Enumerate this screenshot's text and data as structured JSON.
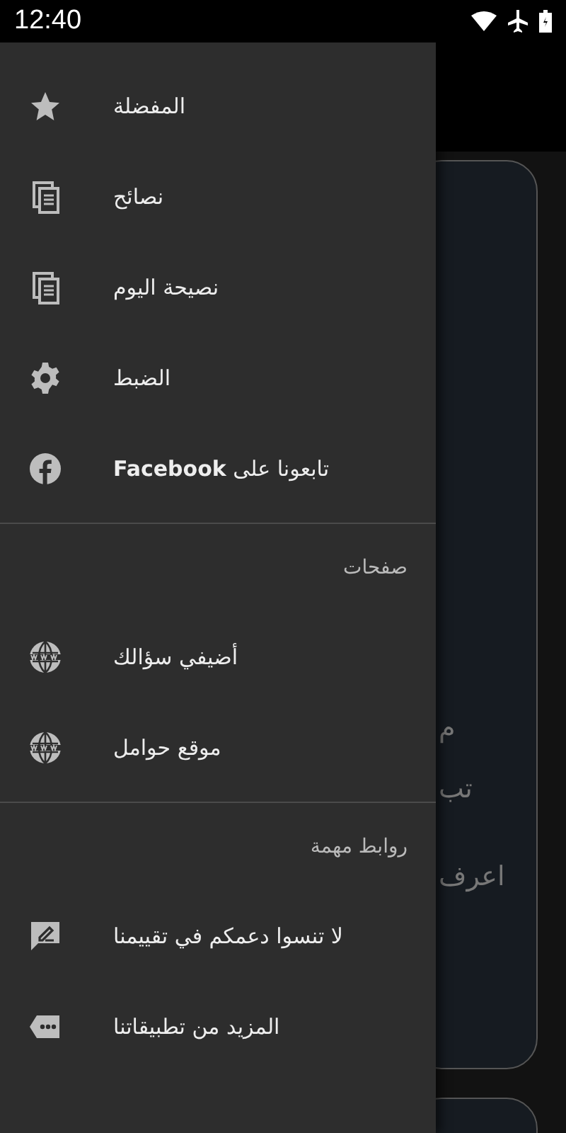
{
  "status_bar": {
    "time": "12:40"
  },
  "background": {
    "texts": [
      "م",
      "تب",
      "اعرف"
    ]
  },
  "drawer": {
    "sections": [
      {
        "items": [
          {
            "kind": "star",
            "label": "المفضلة"
          },
          {
            "kind": "document",
            "label": "نصائح"
          },
          {
            "kind": "document",
            "label": "نصيحة اليوم"
          },
          {
            "kind": "gear",
            "label": "الضبط"
          },
          {
            "kind": "facebook",
            "label": "تابعونا على **Facebook**"
          }
        ]
      },
      {
        "header": "صفحات",
        "items": [
          {
            "kind": "globe",
            "label": "أضيفي سؤالك"
          },
          {
            "kind": "globe",
            "label": "موقع حوامل"
          }
        ]
      },
      {
        "header": "روابط مهمة",
        "items": [
          {
            "kind": "rate",
            "label": "لا تنسوا دعمكم في تقييمنا"
          },
          {
            "kind": "more",
            "label": "المزيد من تطبيقاتنا"
          }
        ]
      }
    ]
  }
}
